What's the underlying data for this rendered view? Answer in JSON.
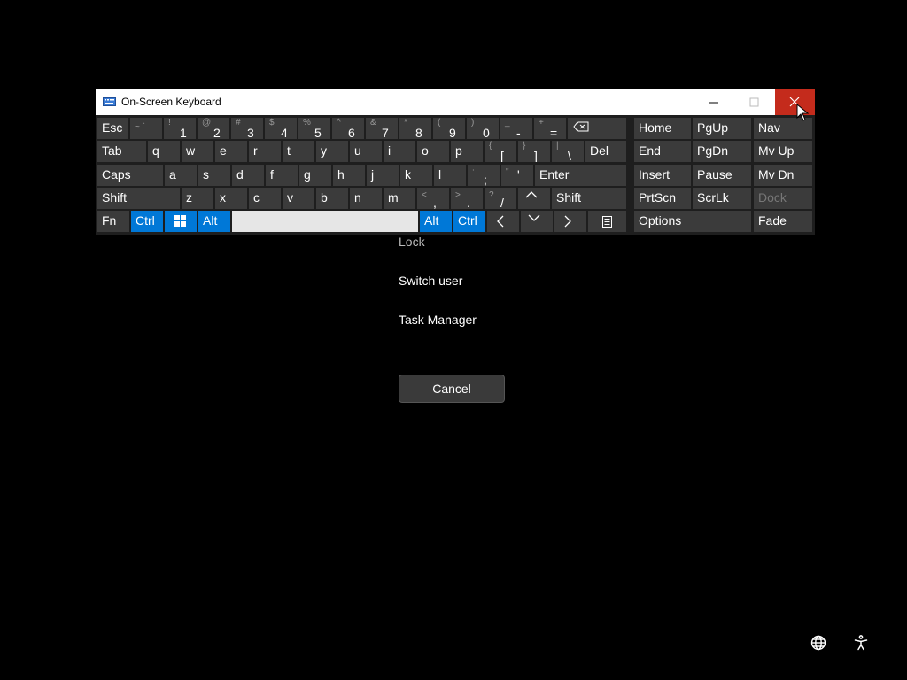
{
  "security_menu": {
    "lock": "Lock",
    "switch_user": "Switch user",
    "task_manager": "Task Manager",
    "cancel": "Cancel"
  },
  "osk": {
    "title": "On-Screen Keyboard",
    "close_color": "#c42b1c",
    "accent": "#0078d7",
    "row1": {
      "esc": "Esc",
      "k1": {
        "shift": "~ `",
        "main": ""
      },
      "k2": {
        "shift": "!",
        "main": "1"
      },
      "k3": {
        "shift": "@",
        "main": "2"
      },
      "k4": {
        "shift": "#",
        "main": "3"
      },
      "k5": {
        "shift": "$",
        "main": "4"
      },
      "k6": {
        "shift": "%",
        "main": "5"
      },
      "k7": {
        "shift": "^",
        "main": "6"
      },
      "k8": {
        "shift": "&",
        "main": "7"
      },
      "k9": {
        "shift": "*",
        "main": "8"
      },
      "k10": {
        "shift": "(",
        "main": "9"
      },
      "k11": {
        "shift": ")",
        "main": "0"
      },
      "k12": {
        "shift": "_",
        "main": "-"
      },
      "k13": {
        "shift": "+",
        "main": "="
      }
    },
    "row2": {
      "tab": "Tab",
      "letters": [
        "q",
        "w",
        "e",
        "r",
        "t",
        "y",
        "u",
        "i",
        "o",
        "p"
      ],
      "k_lbrack": {
        "shift": "{",
        "main": "["
      },
      "k_rbrack": {
        "shift": "}",
        "main": "]"
      },
      "k_bslash": {
        "shift": "|",
        "main": "\\"
      },
      "del": "Del"
    },
    "row3": {
      "caps": "Caps",
      "letters": [
        "a",
        "s",
        "d",
        "f",
        "g",
        "h",
        "j",
        "k",
        "l"
      ],
      "k_semi": {
        "shift": ":",
        "main": ";"
      },
      "k_quote": {
        "shift": "\"",
        "main": "'"
      },
      "enter": "Enter"
    },
    "row4": {
      "shift_left": "Shift",
      "letters": [
        "z",
        "x",
        "c",
        "v",
        "b",
        "n",
        "m"
      ],
      "k_comma": {
        "shift": "<",
        "main": ","
      },
      "k_period": {
        "shift": ">",
        "main": "."
      },
      "k_slash": {
        "shift": "?",
        "main": "/"
      },
      "shift_right": "Shift"
    },
    "row5": {
      "fn": "Fn",
      "ctrl_left": "Ctrl",
      "alt_left": "Alt",
      "alt_right": "Alt",
      "ctrl_right": "Ctrl"
    },
    "nav_block": {
      "home": "Home",
      "pgup": "PgUp",
      "nav": "Nav",
      "end": "End",
      "pgdn": "PgDn",
      "mvup": "Mv Up",
      "insert": "Insert",
      "pause": "Pause",
      "mvdn": "Mv Dn",
      "prtscn": "PrtScn",
      "scrlk": "ScrLk",
      "dock": "Dock",
      "options": "Options",
      "fade": "Fade"
    }
  },
  "icons": {
    "keyboard": "keyboard-icon",
    "backspace": "backspace-icon",
    "windows": "windows-icon",
    "arrow_up": "arrow-up-icon",
    "arrow_down": "arrow-down-icon",
    "arrow_left": "arrow-left-icon",
    "arrow_right": "arrow-right-icon",
    "menu": "context-menu-icon",
    "network": "network-icon",
    "accessibility": "accessibility-icon"
  }
}
